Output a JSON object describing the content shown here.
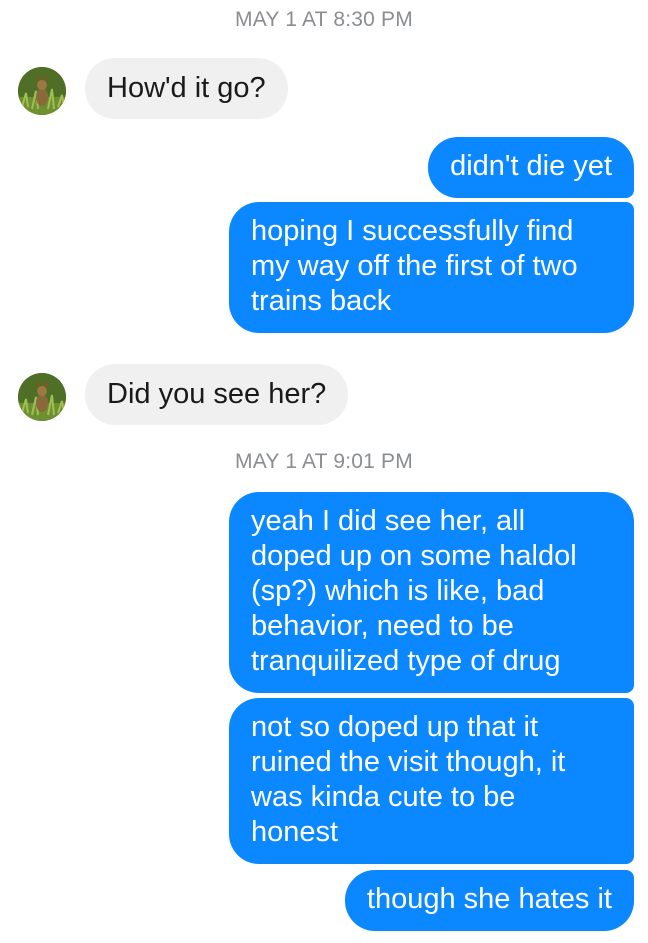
{
  "conversation": {
    "timestamps": [
      "MAY 1 AT 8:30 PM",
      "MAY 1 AT 9:01 PM"
    ],
    "messages": [
      {
        "from": "contact",
        "text": "How'd it go?"
      },
      {
        "from": "me",
        "text": "didn't die yet"
      },
      {
        "from": "me",
        "text": "hoping I successfully find\nmy way off the first of two\ntrains back"
      },
      {
        "from": "contact",
        "text": "Did you see her?"
      },
      {
        "from": "me",
        "text": "yeah I did see her, all\ndoped up on some haldol\n(sp?) which is like, bad\nbehavior, need to be\ntranquilized type of drug"
      },
      {
        "from": "me",
        "text": "not so doped up that it\nruined the visit though, it\nwas kinda cute to be\nhonest"
      },
      {
        "from": "me",
        "text": "though she hates it"
      }
    ]
  },
  "colors": {
    "outgoing_bubble": "#0b87ff",
    "incoming_bubble": "#f0f0f0",
    "timestamp_text": "#8a8d91"
  },
  "icons": {
    "contact_avatar": "profile-photo-animal-in-grass"
  }
}
